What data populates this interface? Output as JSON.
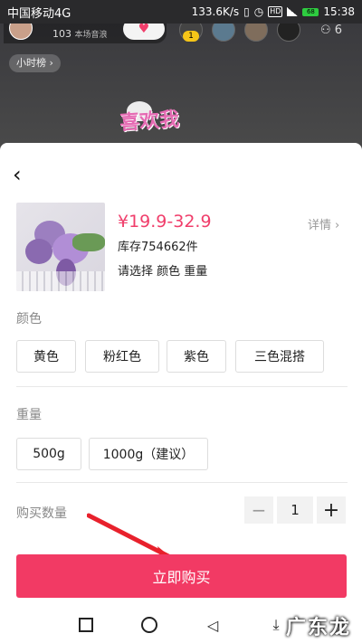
{
  "status_bar": {
    "carrier": "中国移动4G",
    "speed": "133.6K/s",
    "hd": "HD",
    "battery": "68",
    "time": "15:38"
  },
  "live": {
    "host_sub": "103",
    "host_sub_suffix": "本场音浪",
    "rank_badge": "1",
    "viewer_count": "6",
    "hour_rank": "小时榜 ›",
    "deco_text": "喜欢我"
  },
  "sheet": {
    "price": "¥19.9-32.9",
    "stock": "库存754662件",
    "select_hint": "请选择 颜色 重量",
    "details_label": "详情",
    "color_label": "颜色",
    "color_options": [
      "黄色",
      "粉红色",
      "紫色",
      "三色混搭"
    ],
    "weight_label": "重量",
    "weight_options": [
      "500g",
      "1000g（建议）"
    ],
    "qty_label": "购买数量",
    "qty_minus": "−",
    "qty_value": "1",
    "qty_plus": "+",
    "buy_label": "立即购买"
  },
  "watermark": "广东龙网",
  "colors": {
    "accent": "#f23a64",
    "price": "#f03e6b"
  }
}
